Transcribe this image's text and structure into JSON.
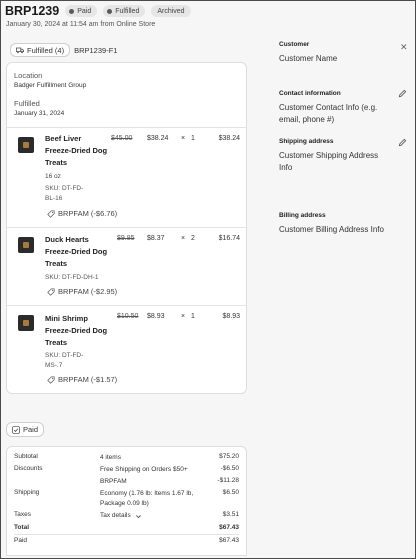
{
  "order": {
    "title": "BRP1239",
    "badges": [
      "Paid",
      "Fulfilled",
      "Archived"
    ],
    "subline": "January 30, 2024 at 11:54 am from Online Store"
  },
  "fulfillment": {
    "status_label": "Fulfilled (4)",
    "id": "BRP1239-F1",
    "location_label": "Location",
    "location_value": "Badger Fulfillment Group",
    "fulfilled_label": "Fulfilled",
    "fulfilled_date": "January 31, 2024"
  },
  "items": [
    {
      "name": "Beef Liver Freeze-Dried Dog Treats",
      "variant": "16 oz",
      "sku": "SKU: DT-FD-BL-16",
      "discount": "BRPFAM (-$6.76)",
      "old_price": "$45.00",
      "price": "$38.24",
      "times": "×",
      "qty": "1",
      "total": "$38.24"
    },
    {
      "name": "Duck Hearts Freeze-Dried Dog Treats",
      "variant": "",
      "sku": "SKU: DT-FD-DH-1",
      "discount": "BRPFAM (-$2.95)",
      "old_price": "$9.85",
      "price": "$8.37",
      "times": "×",
      "qty": "2",
      "total": "$16.74"
    },
    {
      "name": "Mini Shrimp Freeze-Dried Dog Treats",
      "variant": "",
      "sku": "SKU: DT-FD-MS-.7",
      "discount": "BRPFAM (-$1.57)",
      "old_price": "$10.50",
      "price": "$8.93",
      "times": "×",
      "qty": "1",
      "total": "$8.93"
    }
  ],
  "payment": {
    "status_label": "Paid",
    "rows": [
      {
        "label": "Subtotal",
        "detail": "4 items",
        "amount": "$75.20"
      },
      {
        "label": "Discounts",
        "detail": "Free Shipping on Orders $50+",
        "amount": "-$6.50"
      },
      {
        "label": "",
        "detail": "BRPFAM",
        "amount": "-$11.28"
      },
      {
        "label": "Shipping",
        "detail": "Economy (1.76 lb: Items 1.67 lb, Package 0.09 lb)",
        "amount": "$6.50"
      },
      {
        "label": "Taxes",
        "detail": "Tax details",
        "amount": "$3.51"
      },
      {
        "label": "Total",
        "detail": "",
        "amount": "$67.43"
      },
      {
        "label": "Paid",
        "detail": "",
        "amount": "$67.43"
      }
    ]
  },
  "sidebar": {
    "customer_heading": "Customer",
    "customer_name": "Customer Name",
    "contact_heading": "Contact information",
    "contact_value": "Customer Contact Info (e.g. email, phone #)",
    "shipping_heading": "Shipping address",
    "shipping_value": "Customer Shipping Address Info",
    "billing_heading": "Billing address",
    "billing_value": "Customer Billing Address Info"
  },
  "icons": {
    "close": "close-icon",
    "edit": "pencil-icon",
    "tag": "tag-icon",
    "fulfilled": "truck-icon",
    "paid": "check-icon"
  }
}
